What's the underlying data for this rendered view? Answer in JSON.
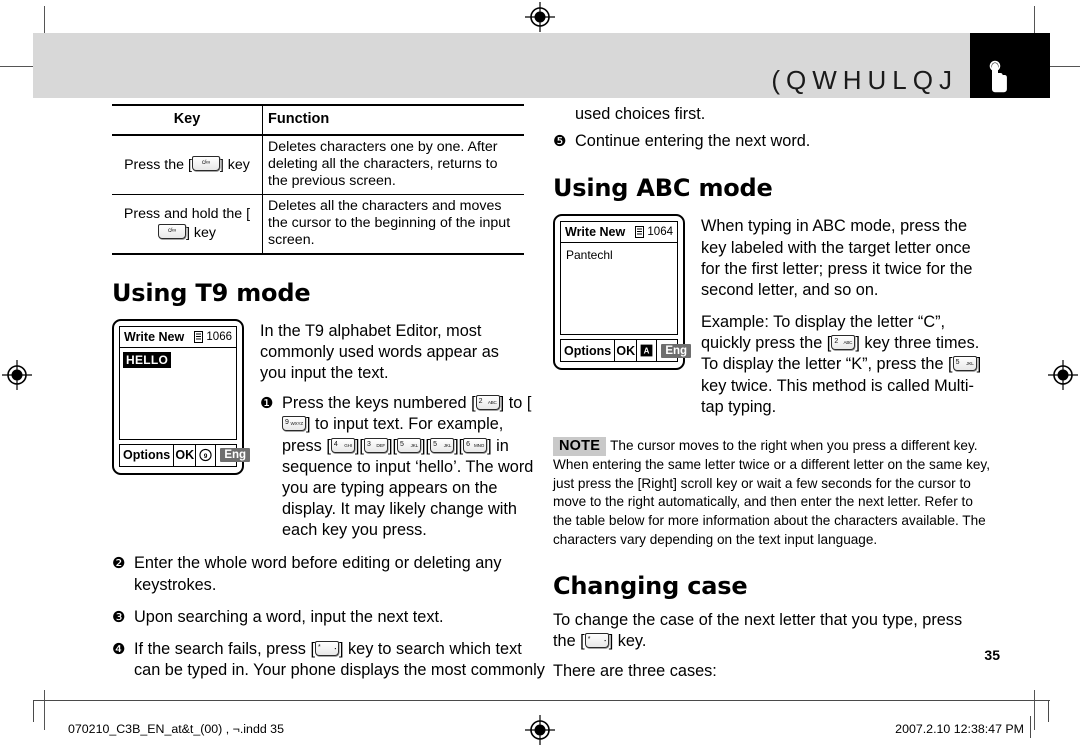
{
  "header": {
    "title": "(QWHULQJ",
    "hand_icon": "pointing-hand-icon"
  },
  "key_table": {
    "headers": [
      "Key",
      "Function"
    ],
    "rows": [
      {
        "key_pre": "Press the [",
        "key_glyph": "c/∞",
        "key_post": "] key",
        "function": "Deletes characters one by one. After deleting all the characters, returns to the previous screen."
      },
      {
        "key_pre": "Press and hold the [",
        "key_glyph": "c/∞",
        "key_post": "] key",
        "function": "Deletes all the characters and moves the cursor to the beginning of the input screen."
      }
    ]
  },
  "t9": {
    "heading": "Using T9 mode",
    "phone": {
      "title": "Write New",
      "counter": "1066",
      "list_icon": "memo-list-icon",
      "text": "HELLO",
      "softkeys": {
        "left": "Options",
        "center": "OK",
        "icon": "t9-mode-icon",
        "right": "Eng"
      }
    },
    "intro": "In the T9 alphabet Editor, most commonly used words appear as you input the text.",
    "steps": [
      {
        "marker": "❶",
        "parts": [
          {
            "t": "Press the keys numbered ["
          },
          {
            "key": {
              "num": "2",
              "sub": "ABC"
            }
          },
          {
            "t": "] to ["
          },
          {
            "key": {
              "num": "9",
              "sub": "WXYZ"
            }
          },
          {
            "t": "] to input text. For example, press ["
          },
          {
            "key": {
              "num": "4",
              "sub": "GHI"
            }
          },
          {
            "t": "]["
          },
          {
            "key": {
              "num": "3",
              "sub": "DEF"
            }
          },
          {
            "t": "]["
          },
          {
            "key": {
              "num": "5",
              "sub": "JKL"
            }
          },
          {
            "t": "]["
          },
          {
            "key": {
              "num": "5",
              "sub": "JKL"
            }
          },
          {
            "t": "]["
          },
          {
            "key": {
              "num": "6",
              "sub": "MNO"
            }
          },
          {
            "t": "] in sequence to input ‘hello’. The word you are typing appears on the display. It may likely change with each key you press."
          }
        ]
      },
      {
        "marker": "❷",
        "parts": [
          {
            "t": "Enter the whole word before editing or deleting any keystrokes."
          }
        ]
      },
      {
        "marker": "❸",
        "parts": [
          {
            "t": "Upon searching a word, input the next text."
          }
        ]
      },
      {
        "marker": "❹",
        "parts": [
          {
            "t": "If the search fails, press ["
          },
          {
            "key": {
              "num": "*",
              "sub": "▪"
            }
          },
          {
            "t": "] key to search which text can be typed in. Your phone displays the most commonly used choices first."
          }
        ]
      },
      {
        "marker": "❺",
        "parts": [
          {
            "t": "Continue entering the next word."
          }
        ]
      }
    ],
    "step4_continuation": "used choices first."
  },
  "abc": {
    "heading": "Using ABC mode",
    "phone": {
      "title": "Write New",
      "counter": "1064",
      "list_icon": "memo-list-icon",
      "text": "Pantechl",
      "softkeys": {
        "left": "Options",
        "center": "OK",
        "icon": "abc-mode-icon",
        "right": "Eng"
      }
    },
    "para1": "When typing in ABC mode, press the key labeled with the target letter once for the first letter; press it twice for the second letter, and so on.",
    "para2_parts": [
      {
        "t": "Example: To display the letter “C”, quickly press the ["
      },
      {
        "key": {
          "num": "2",
          "sub": "ABC"
        }
      },
      {
        "t": "] key three times. To display the letter “K”, press the ["
      },
      {
        "key": {
          "num": "5",
          "sub": "JKL"
        }
      },
      {
        "t": "] key twice. This method is called Multi-tap typing."
      }
    ]
  },
  "note": {
    "badge": "NOTE",
    "text": "The cursor moves to the right when you press a different key. When entering the same letter twice or a different letter on the same key, just press the [Right] scroll key or wait a few seconds for the cursor to move to the right automatically, and then enter the next letter. Refer to the table below for more information about the characters available. The characters vary depending on the text input language."
  },
  "changing_case": {
    "heading": "Changing case",
    "para_parts": [
      {
        "t": "To change the case of the next letter that you type, press the ["
      },
      {
        "key": {
          "num": "*",
          "sub": "▪"
        }
      },
      {
        "t": "] key."
      }
    ],
    "para2": "There are three cases:"
  },
  "page_number": "35",
  "footer": {
    "left": "070210_C3B_EN_at&t_(00) , ¬.indd   35",
    "right": "2007.2.10   12:38:47 PM"
  }
}
